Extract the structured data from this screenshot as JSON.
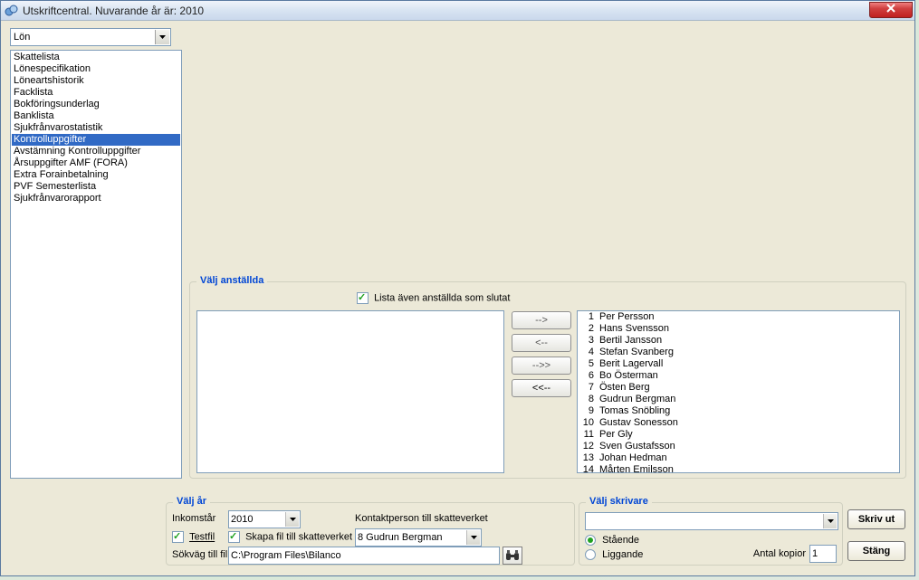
{
  "title": "Utskriftcentral. Nuvarande år är: 2010",
  "category": "Lön",
  "reports": [
    "Skattelista",
    "Lönespecifikation",
    "Löneartshistorik",
    "Facklista",
    "Bokföringsunderlag",
    "Banklista",
    "Sjukfrånvarostatistik",
    "Kontrolluppgifter",
    "Avstämning Kontrolluppgifter",
    "Årsuppgifter AMF (FORA)",
    "Extra Forainbetalning",
    "PVF Semesterlista",
    "Sjukfrånvarorapport"
  ],
  "selected_report_index": 7,
  "employees_group": {
    "title": "Välj anställda",
    "list_closed_label": "Lista även anställda som slutat",
    "list_closed_checked": true,
    "transfer_right": "-->",
    "transfer_left": "<--",
    "transfer_all_right": "-->>",
    "transfer_all_left": "<<--",
    "available": [
      {
        "n": 1,
        "name": "Per Persson"
      },
      {
        "n": 2,
        "name": "Hans Svensson"
      },
      {
        "n": 3,
        "name": "Bertil Jansson"
      },
      {
        "n": 4,
        "name": "Stefan Svanberg"
      },
      {
        "n": 5,
        "name": "Berit Lagervall"
      },
      {
        "n": 6,
        "name": "Bo Österman"
      },
      {
        "n": 7,
        "name": "Östen Berg"
      },
      {
        "n": 8,
        "name": "Gudrun Bergman"
      },
      {
        "n": 9,
        "name": "Tomas Snöbling"
      },
      {
        "n": 10,
        "name": "Gustav Sonesson"
      },
      {
        "n": 11,
        "name": "Per Gly"
      },
      {
        "n": 12,
        "name": "Sven Gustafsson"
      },
      {
        "n": 13,
        "name": "Johan Hedman"
      },
      {
        "n": 14,
        "name": "Mårten Emilsson"
      }
    ]
  },
  "year_group": {
    "title": "Välj år",
    "income_year_label": "Inkomstår",
    "income_year_value": "2010",
    "testfile_label": "Testfil",
    "testfile_checked": true,
    "create_file_label": "Skapa fil till skatteverket",
    "create_file_checked": true,
    "contact_label": "Kontaktperson till skatteverket",
    "contact_value": "8 Gudrun Bergman",
    "path_label": "Sökväg till fil",
    "path_value": "C:\\Program Files\\Bilanco"
  },
  "printer_group": {
    "title": "Välj skrivare",
    "printer_value": "",
    "portrait_label": "Stående",
    "landscape_label": "Liggande",
    "orientation": "portrait",
    "copies_label": "Antal kopior",
    "copies_value": "1"
  },
  "buttons": {
    "print": "Skriv ut",
    "close": "Stäng"
  }
}
